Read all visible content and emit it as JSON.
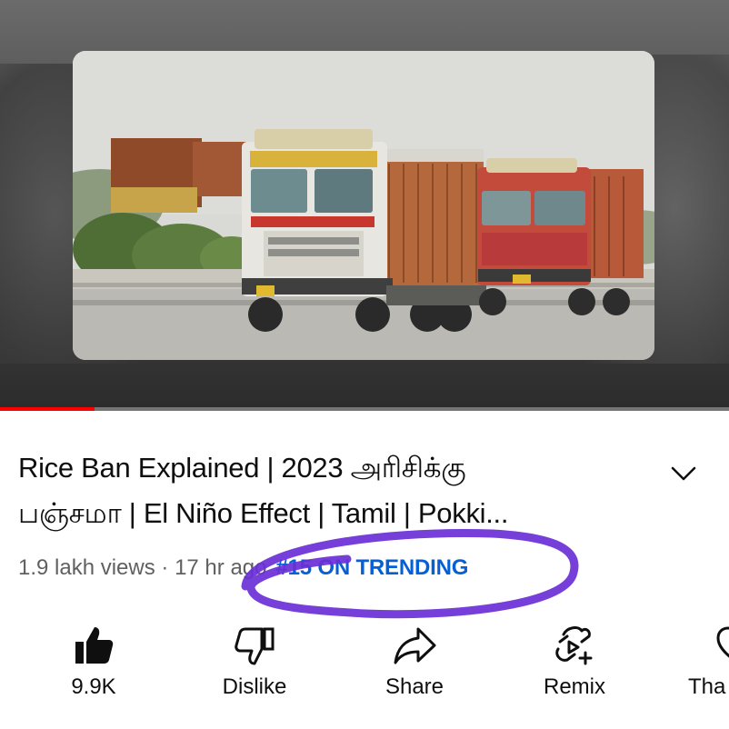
{
  "video": {
    "title_line1": "Rice Ban Explained | 2023 அரிசிக்கு",
    "title_line2": "பஞ்சமா | El Niño Effect | Tamil | Pokki...",
    "views": "1.9 lakh views · 17 hr ago",
    "trending": "#15 ON TRENDING",
    "progress_fraction": 0.13
  },
  "actions": {
    "like": "9.9K",
    "dislike": "Dislike",
    "share": "Share",
    "remix": "Remix",
    "thanks": "Tha"
  },
  "colors": {
    "trending": "#065fd4",
    "annotation": "#6b2fd6",
    "progress": "#ff0000"
  },
  "icons": [
    "chevron-down-icon",
    "like-icon",
    "dislike-icon",
    "share-icon",
    "remix-icon",
    "thanks-icon"
  ]
}
